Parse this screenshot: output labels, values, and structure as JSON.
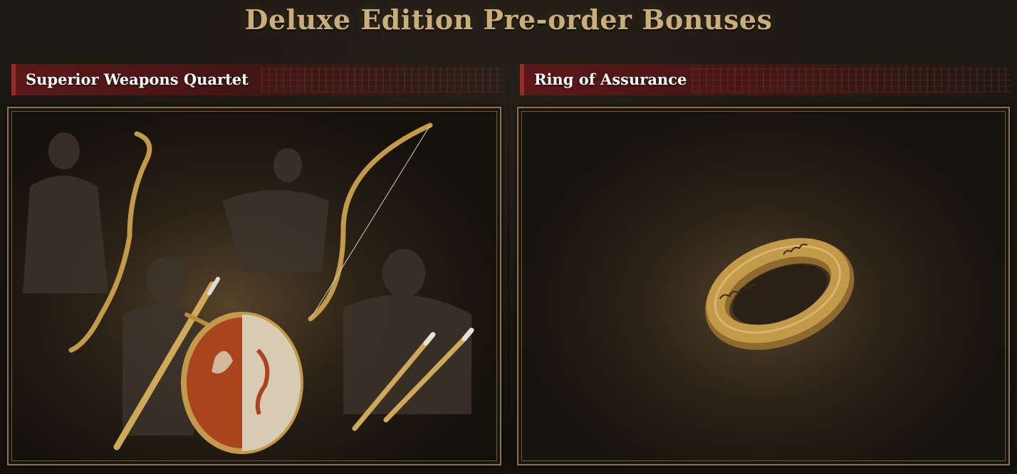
{
  "page": {
    "title": "Deluxe Edition Pre-order Bonuses"
  },
  "sections": [
    {
      "id": "left",
      "title": "Superior Weapons Quartet",
      "items": [
        "staff",
        "bow",
        "sword",
        "shield",
        "dagger",
        "dagger"
      ]
    },
    {
      "id": "right",
      "title": "Ring of Assurance",
      "items": [
        "ring"
      ]
    }
  ],
  "colors": {
    "title_gold": "#c9ad7a",
    "header_red": "#5b1818",
    "header_accent": "#9b2a24",
    "frame_gold": "#8a7350",
    "item_gold": "#c29a4a",
    "shield_red": "#8a3a22"
  }
}
